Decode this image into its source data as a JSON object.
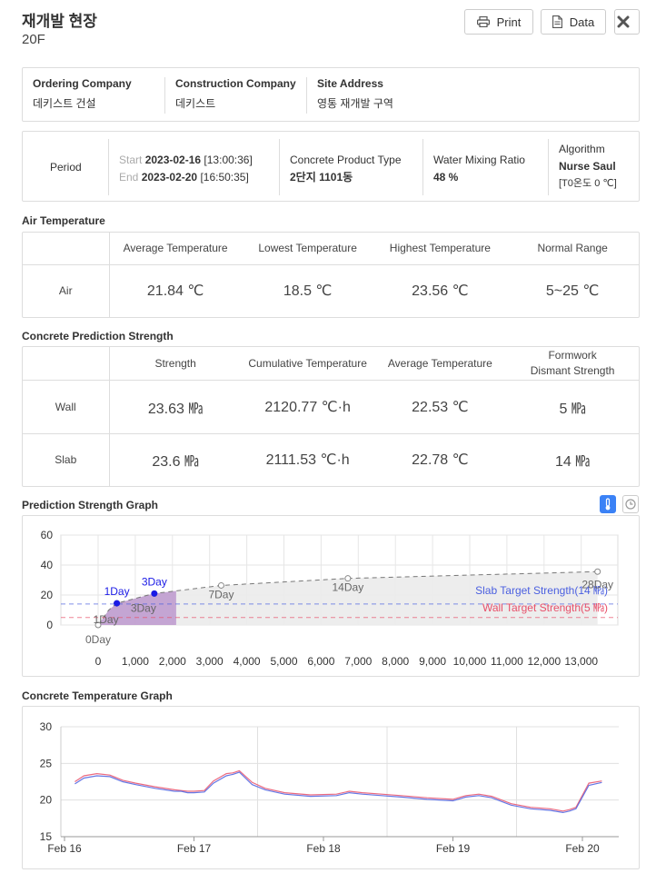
{
  "header": {
    "title": "재개발 현장",
    "floor": "20F",
    "print_label": "Print",
    "data_label": "Data"
  },
  "company": {
    "ordering_label": "Ordering Company",
    "ordering_value": "데키스트 건설",
    "construction_label": "Construction Company",
    "construction_value": "데키스트",
    "address_label": "Site Address",
    "address_value": "영통 재개발 구역"
  },
  "period": {
    "label": "Period",
    "start_label": "Start",
    "start_date": "2023-02-16",
    "start_time": "[13:00:36]",
    "end_label": "End",
    "end_date": "2023-02-20",
    "end_time": "[16:50:35]",
    "product_label": "Concrete Product Type",
    "product_value": "2단지 1101동",
    "water_label": "Water Mixing Ratio",
    "water_value": "48 %",
    "algorithm_label": "Algorithm",
    "algorithm_value": "Nurse Saul",
    "algorithm_note": "[T0온도 0 ℃]"
  },
  "air": {
    "section_title": "Air Temperature",
    "headers": [
      "Average Temperature",
      "Lowest Temperature",
      "Highest Temperature",
      "Normal Range"
    ],
    "row_label": "Air",
    "values": [
      "21.84 ℃",
      "18.5 ℃",
      "23.56 ℃",
      "5~25 ℃"
    ]
  },
  "strength": {
    "section_title": "Concrete Prediction Strength",
    "headers": [
      "Strength",
      "Cumulative Temperature",
      "Average Temperature",
      "Formwork Dismant Strength"
    ],
    "rows": [
      {
        "label": "Wall",
        "values": [
          "23.63 ㎫",
          "2120.77 ℃·h",
          "22.53 ℃",
          "5 ㎫"
        ]
      },
      {
        "label": "Slab",
        "values": [
          "23.6 ㎫",
          "2111.53 ℃·h",
          "22.78 ℃",
          "14 ㎫"
        ]
      }
    ]
  },
  "colors": {
    "slab_line": "#4a5fe0",
    "wall_line": "#e8506a",
    "point_blue": "#1a1ae6",
    "area_purple": "#b58cc9",
    "toggle_active": "#3b82f6"
  },
  "chart_data": [
    {
      "type": "line",
      "title": "Prediction Strength Graph",
      "x_ticks": [
        "0",
        "1,000",
        "2,000",
        "3,000",
        "4,000",
        "5,000",
        "6,000",
        "7,000",
        "8,000",
        "9,000",
        "10,000",
        "11,000",
        "12,000",
        "13,000"
      ],
      "xlim": [
        0,
        14000
      ],
      "ylim": [
        0,
        60
      ],
      "y_ticks": [
        "0",
        "20",
        "40",
        "60"
      ],
      "curve": [
        [
          0,
          0
        ],
        [
          288,
          10
        ],
        [
          504,
          14.5
        ],
        [
          1440,
          20.6
        ],
        [
          1512,
          21
        ],
        [
          3312,
          26.4
        ],
        [
          6720,
          31.1
        ],
        [
          13440,
          35.6
        ]
      ],
      "current_points": [
        {
          "x": 504,
          "y": 14.5,
          "label": "1Day"
        },
        {
          "x": 1512,
          "y": 21,
          "label": "3Day"
        }
      ],
      "day_labels": [
        {
          "x": 0,
          "y": 0,
          "label": "0Day"
        },
        {
          "x": 504,
          "y": 14.5,
          "label": "1Day"
        },
        {
          "x": 1512,
          "y": 21,
          "label": "3Day"
        },
        {
          "x": 3312,
          "y": 26.4,
          "label": "7Day"
        },
        {
          "x": 6720,
          "y": 31.1,
          "label": "14Day"
        },
        {
          "x": 13440,
          "y": 35.6,
          "label": "28Day"
        }
      ],
      "shaded_until_x": 2100,
      "lines": [
        {
          "name": "Slab Target Strength(14 ㎫)",
          "y": 14
        },
        {
          "name": "Wall Target Strength(5 ㎫)",
          "y": 5
        }
      ]
    },
    {
      "type": "line",
      "title": "Concrete Temperature Graph",
      "x_ticks": [
        "Feb 16",
        "Feb 17",
        "Feb 18",
        "Feb 19",
        "Feb 20"
      ],
      "xlim": [
        0,
        4.2
      ],
      "ylim": [
        15,
        30
      ],
      "y_ticks": [
        "15",
        "20",
        "25",
        "30"
      ],
      "series": [
        {
          "name": "",
          "x": [
            0.08,
            0.15,
            0.25,
            0.35,
            0.45,
            0.55,
            0.7,
            0.85,
            0.9,
            0.95,
            1.0,
            1.08,
            1.15,
            1.25,
            1.3,
            1.35,
            1.45,
            1.55,
            1.7,
            1.9,
            2.1,
            2.2,
            2.3,
            2.45,
            2.6,
            2.8,
            3.0,
            3.1,
            3.2,
            3.3,
            3.45,
            3.6,
            3.75,
            3.85,
            3.9,
            3.95,
            4.05,
            4.15
          ],
          "y": [
            22.5,
            23.3,
            23.6,
            23.4,
            22.7,
            22.3,
            21.8,
            21.4,
            21.3,
            21.2,
            21.2,
            21.3,
            22.6,
            23.6,
            23.7,
            24.0,
            22.4,
            21.6,
            21.0,
            20.7,
            20.8,
            21.2,
            21.0,
            20.8,
            20.6,
            20.3,
            20.1,
            20.6,
            20.8,
            20.5,
            19.5,
            19.0,
            18.8,
            18.5,
            18.7,
            19.0,
            22.3,
            22.6
          ]
        },
        {
          "name": "",
          "x": [
            0.08,
            0.15,
            0.25,
            0.35,
            0.45,
            0.55,
            0.7,
            0.85,
            0.9,
            0.95,
            1.0,
            1.08,
            1.15,
            1.25,
            1.3,
            1.35,
            1.45,
            1.55,
            1.7,
            1.9,
            2.1,
            2.2,
            2.3,
            2.45,
            2.6,
            2.8,
            3.0,
            3.1,
            3.2,
            3.3,
            3.45,
            3.6,
            3.75,
            3.85,
            3.9,
            3.95,
            4.05,
            4.15
          ],
          "y": [
            22.2,
            23.0,
            23.3,
            23.2,
            22.5,
            22.1,
            21.6,
            21.2,
            21.2,
            21.0,
            21.0,
            21.1,
            22.3,
            23.3,
            23.5,
            23.8,
            22.1,
            21.4,
            20.8,
            20.5,
            20.6,
            21.0,
            20.8,
            20.6,
            20.4,
            20.1,
            19.9,
            20.4,
            20.6,
            20.3,
            19.3,
            18.8,
            18.6,
            18.3,
            18.5,
            18.8,
            22.0,
            22.4
          ]
        }
      ]
    }
  ]
}
